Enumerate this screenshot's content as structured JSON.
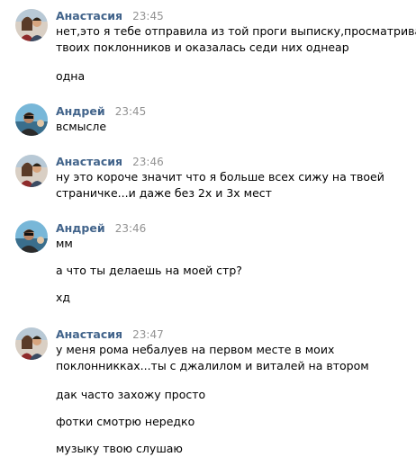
{
  "messages": [
    {
      "author": "Анастасия",
      "time": "23:45",
      "lines": [
        "нет,это я тебе отправила из той проги выписку,просматривала",
        "твоих поклонников и оказалась седи них однеар",
        "одна"
      ]
    },
    {
      "author": "Андрей",
      "time": "23:45",
      "lines": [
        "всмысле"
      ]
    },
    {
      "author": "Анастасия",
      "time": "23:46",
      "lines": [
        "ну это короче значит что я больше всех сижу на твоей",
        "страничке...и даже без 2х и 3х мест"
      ]
    },
    {
      "author": "Андрей",
      "time": "23:46",
      "lines": [
        "мм",
        "а что ты делаешь на моей стр?",
        "хд"
      ]
    },
    {
      "author": "Анастасия",
      "time": "23:47",
      "lines": [
        "у меня рома небалуев на первом месте в моих",
        "поклонникках...ты с джалилом и виталей на втором",
        "дак часто захожу просто",
        "фотки смотрю нередко",
        "музыку твою слушаю"
      ]
    }
  ],
  "colors": {
    "author": "#42648b",
    "time": "#939393",
    "text": "#000000"
  },
  "icons": {
    "anastasia_avatar": "avatar-photo-icon",
    "andrey_avatar": "avatar-photo-icon"
  }
}
